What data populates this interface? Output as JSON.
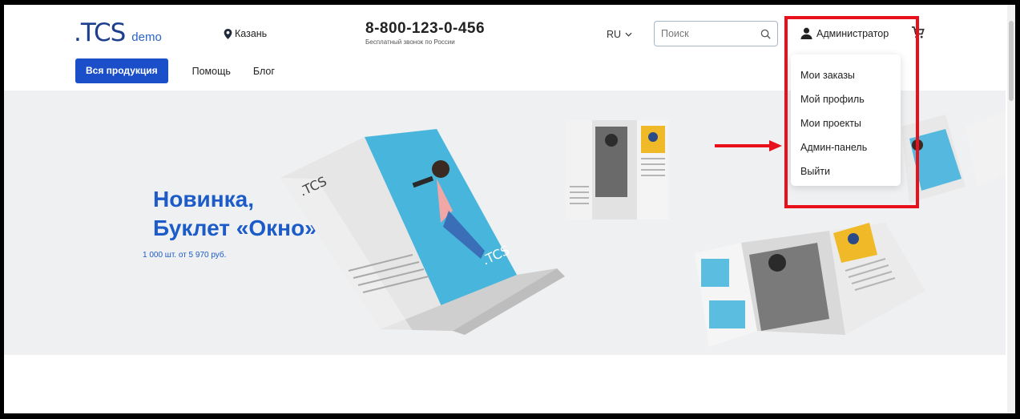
{
  "header": {
    "logo": ".TCS",
    "logo_suffix": "demo",
    "city": "Казань",
    "phone": "8-800-123-0-456",
    "phone_note": "Бесплатный звонок по России",
    "language": "RU",
    "search_placeholder": "Поиск",
    "user": "Администратор"
  },
  "nav": {
    "items": [
      "Вся продукция",
      "Помощь",
      "Блог"
    ]
  },
  "hero": {
    "title_line1": "Новинка,",
    "title_line2": "Буклет «Окно»",
    "subtitle": "1 000 шт. от 5 970 руб.",
    "booklet_brand": ".TCS"
  },
  "user_menu": {
    "items": [
      "Мои заказы",
      "Мой профиль",
      "Мои проекты",
      "Админ-панель",
      "Выйти"
    ]
  },
  "colors": {
    "brand_blue": "#1a4fc9",
    "annotation_red": "#e8101a",
    "hero_bg": "#eff0f2"
  },
  "icons": {
    "city": "map-pin-icon",
    "lang": "chevron-down-icon",
    "search": "search-icon",
    "user": "user-icon",
    "cart": "cart-icon"
  }
}
